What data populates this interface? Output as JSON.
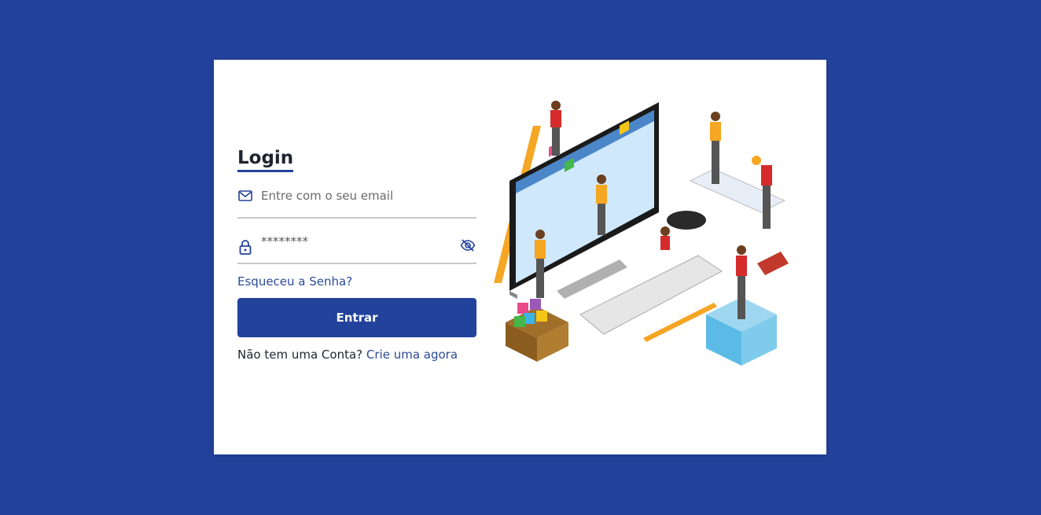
{
  "login": {
    "title": "Login",
    "email_placeholder": "Entre com o seu email",
    "password_value": "********",
    "forgot_label": "Esqueceu a Senha?",
    "submit_label": "Entrar",
    "signup_prompt": "Não tem uma Conta?",
    "signup_link": "Crie uma agora"
  },
  "icons": {
    "email": "mail-icon",
    "password": "lock-icon",
    "toggle": "eye-off-icon"
  },
  "colors": {
    "background": "#23429c",
    "accent": "#23429c",
    "link": "#2b4a9a",
    "card": "#ffffff"
  }
}
